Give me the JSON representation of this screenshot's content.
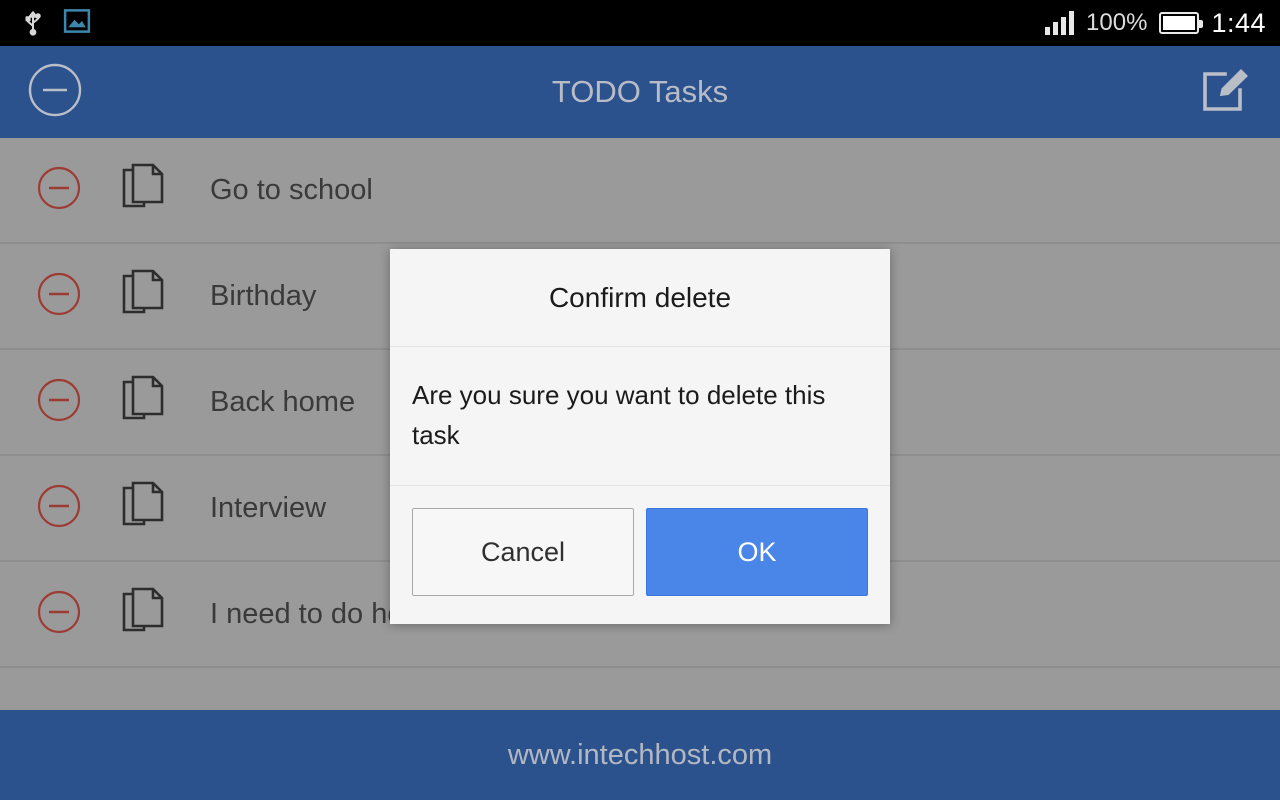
{
  "status_bar": {
    "usb_icon": "usb-icon",
    "screenshot_icon": "image-icon",
    "battery_percent": "100%",
    "time": "1:44"
  },
  "app_bar": {
    "title": "TODO Tasks",
    "left_icon": "circle-minus-icon",
    "right_icon": "compose-edit-icon"
  },
  "tasks": [
    {
      "label": "Go to school"
    },
    {
      "label": "Birthday"
    },
    {
      "label": "Back home"
    },
    {
      "label": "Interview"
    },
    {
      "label": "I need to do homework"
    }
  ],
  "dialog": {
    "title": "Confirm delete",
    "message": "Are you sure you want to delete this task",
    "cancel_label": "Cancel",
    "ok_label": "OK"
  },
  "footer": {
    "text": "www.intechhost.com"
  },
  "colors": {
    "app_bar_blue": "#2c528e",
    "ok_button_blue": "#4a86e8",
    "list_background": "#999999",
    "delete_icon_red": "#9c3b32",
    "status_bar_black": "#000000"
  }
}
